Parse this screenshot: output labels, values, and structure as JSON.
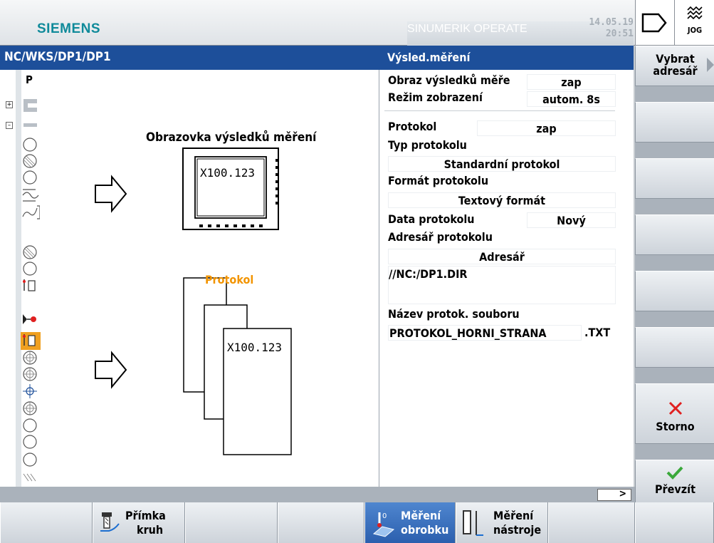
{
  "header": {
    "brand": "SIEMENS",
    "product": "SINUMERIK OPERATE",
    "date": "14.05.19",
    "time": "20:51",
    "jog_label": "JOG"
  },
  "title_bar": {
    "path": "NC/WKS/DP1/DP1",
    "panel_title": "Výsled.měření"
  },
  "graphic": {
    "screen_caption": "Obrazovka výsledků měření",
    "screen_value": "X100.123",
    "protocol_caption": "Protokol",
    "protocol_value": "X100.123"
  },
  "strip": {
    "top_label": "P"
  },
  "params": {
    "display_label": "Obraz výsledků měře",
    "display_value": "zap",
    "mode_label": "Režim zobrazení",
    "mode_value": "autom. 8s",
    "protocol_label": "Protokol",
    "protocol_value": "zap",
    "type_label": "Typ protokolu",
    "type_value": "Standardní protokol",
    "format_label": "Formát protokolu",
    "format_value": "Textový formát",
    "data_label": "Data protokolu",
    "data_value": "Nový",
    "dir_label": "Adresář protokolu",
    "dir_value": "Adresář",
    "dir_path": "//NC:/DP1.DIR",
    "file_label": "Název protok. souboru",
    "file_name": "PROTOKOL_HORNI_STRANA",
    "file_ext": ".TXT"
  },
  "right_softkeys": {
    "select_dir_line1": "Vybrat",
    "select_dir_line2": "adresář",
    "cancel": "Storno",
    "accept": "Převzít"
  },
  "bottom_softkeys": {
    "line_circle_1": "Přímka",
    "line_circle_2": "kruh",
    "meas_workpiece_1": "Měření",
    "meas_workpiece_2": "obrobku",
    "meas_tool_1": "Měření",
    "meas_tool_2": "nástroje"
  },
  "colors": {
    "title_blue": "#1d4f9a",
    "brand_teal": "#0f8a9a",
    "highlight_orange": "#f29400",
    "cancel_red": "#e02020",
    "accept_green": "#3aa83a"
  }
}
